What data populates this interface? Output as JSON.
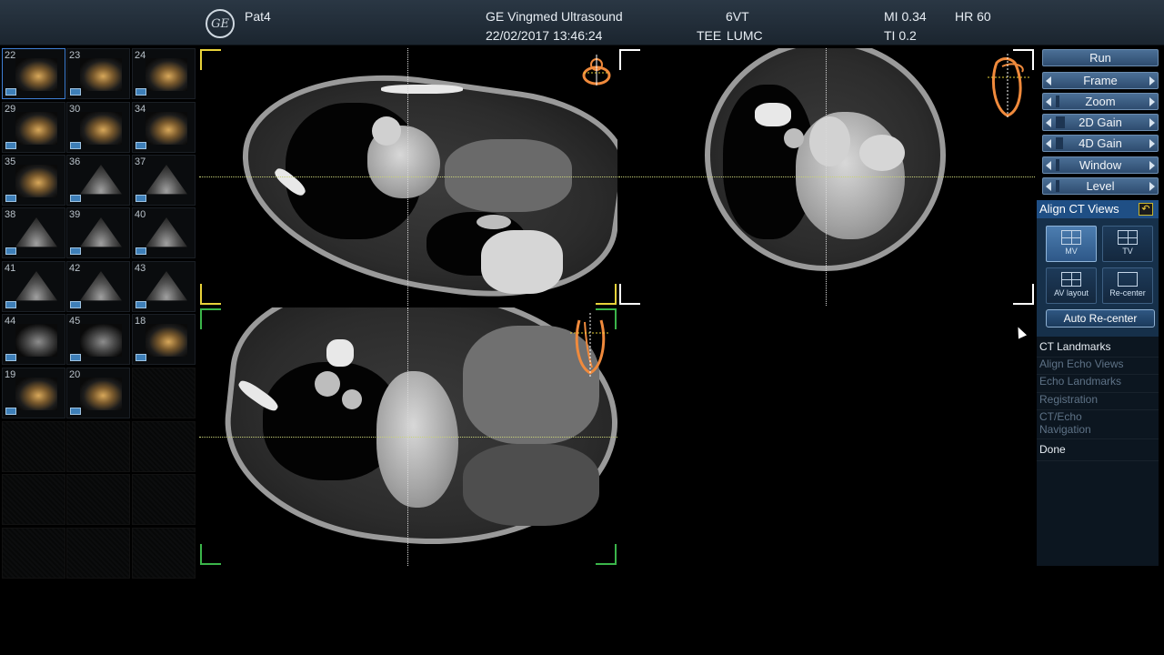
{
  "header": {
    "patient": "Pat4",
    "system": "GE Vingmed Ultrasound",
    "datetime": "22/02/2017 13:46:24",
    "probe": "6VT",
    "mode": "TEE",
    "site": "LUMC",
    "mi": "MI 0.34",
    "ti": "TI 0.2",
    "hr": "HR 60",
    "logo": "GE"
  },
  "thumbnails": [
    {
      "num": "22",
      "kind": "col",
      "selected": true
    },
    {
      "num": "23",
      "kind": "col"
    },
    {
      "num": "24",
      "kind": "col"
    },
    {
      "num": "29",
      "kind": "col"
    },
    {
      "num": "30",
      "kind": "col"
    },
    {
      "num": "34",
      "kind": "col"
    },
    {
      "num": "35",
      "kind": "col"
    },
    {
      "num": "36",
      "kind": "fan"
    },
    {
      "num": "37",
      "kind": "fan"
    },
    {
      "num": "38",
      "kind": "fan"
    },
    {
      "num": "39",
      "kind": "fan"
    },
    {
      "num": "40",
      "kind": "fan"
    },
    {
      "num": "41",
      "kind": "fan"
    },
    {
      "num": "42",
      "kind": "fan"
    },
    {
      "num": "43",
      "kind": "fan"
    },
    {
      "num": "44",
      "kind": "gray"
    },
    {
      "num": "45",
      "kind": "gray"
    },
    {
      "num": "18",
      "kind": "col"
    },
    {
      "num": "19",
      "kind": "col"
    },
    {
      "num": "20",
      "kind": "col"
    }
  ],
  "controls": {
    "run": "Run",
    "frame": "Frame",
    "zoom": "Zoom",
    "gain2d": "2D Gain",
    "gain4d": "4D Gain",
    "window": "Window",
    "level": "Level"
  },
  "align_panel": {
    "title": "Align CT Views",
    "tiles": [
      {
        "label": "MV",
        "active": true
      },
      {
        "label": "TV",
        "active": false
      },
      {
        "label": "AV layout",
        "active": false
      },
      {
        "label": "Re-center",
        "active": false
      }
    ],
    "auto_recenter": "Auto Re-center"
  },
  "workflow": {
    "ct_landmarks": "CT Landmarks",
    "align_echo": "Align Echo Views",
    "echo_landmarks": "Echo Landmarks",
    "registration": "Registration",
    "ct_echo_nav_1": "CT/Echo",
    "ct_echo_nav_2": "Navigation",
    "done": "Done"
  },
  "colors": {
    "accent": "#3f7fd4",
    "orientation": "#f08a3c",
    "crosshair": "#c9d27a"
  }
}
